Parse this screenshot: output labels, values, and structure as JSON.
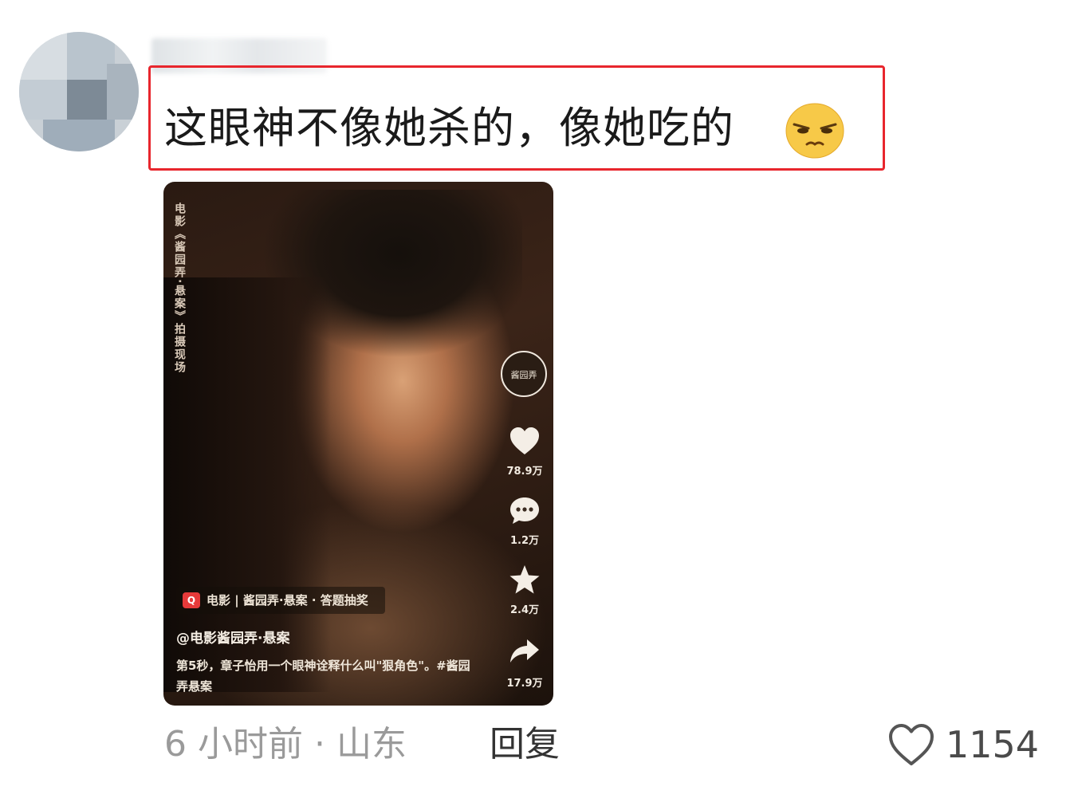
{
  "comment": {
    "text": "这眼神不像她杀的，像她吃的",
    "emoji": "smirk-emoji"
  },
  "video": {
    "vertical_caption": "电影《酱园弄·悬案》拍摄现场",
    "channel_logo_text": "酱园弄",
    "likes": "78.9万",
    "comments": "1.2万",
    "favorites": "2.4万",
    "shares": "17.9万",
    "tag_logo": "Q",
    "tag_text": "电影 | 酱园弄·悬案 · 答题抽奖",
    "account": "@电影酱园弄·悬案",
    "description": "第5秒，章子怡用一个眼神诠释什么叫\"狠角色\"。#酱园弄悬案"
  },
  "footer": {
    "meta": "6 小时前 · 山东",
    "reply": "回复",
    "like_count": "1154"
  },
  "colors": {
    "highlight_border": "#e8262d",
    "meta_text": "#9a9a9a"
  }
}
